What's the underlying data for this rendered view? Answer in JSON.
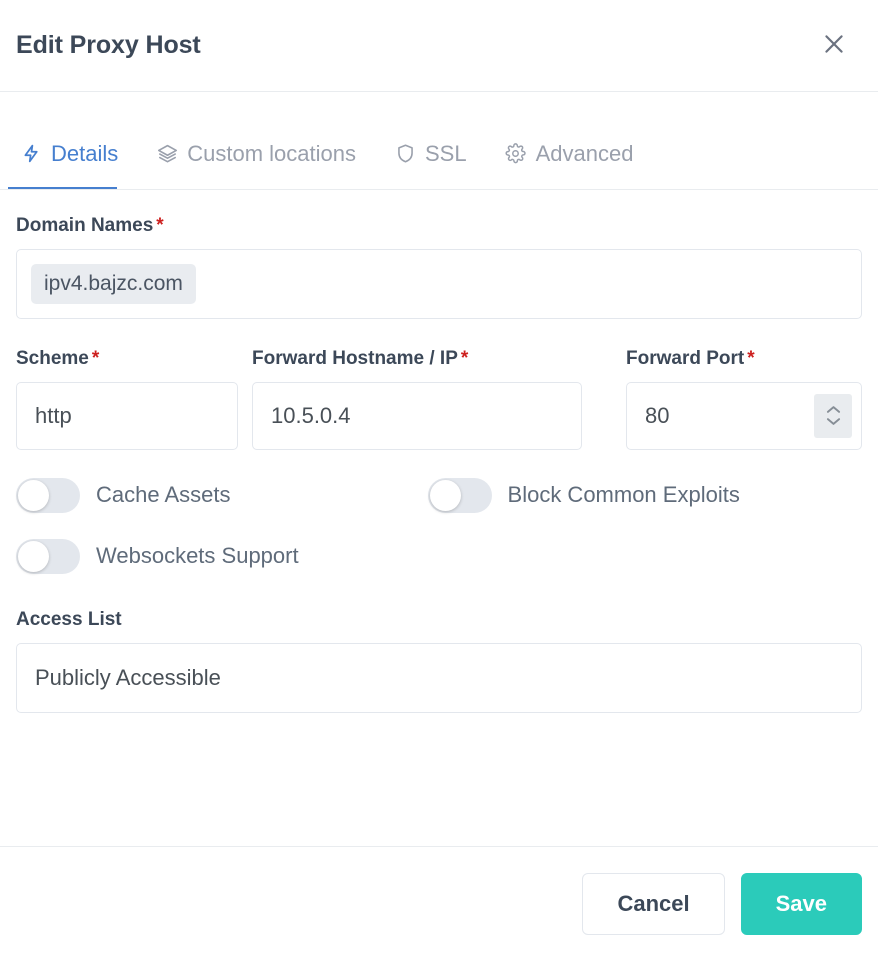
{
  "header": {
    "title": "Edit Proxy Host",
    "close_icon": "close-icon"
  },
  "tabs": [
    {
      "label": "Details",
      "icon": "bolt-icon",
      "active": true
    },
    {
      "label": "Custom locations",
      "icon": "layers-icon",
      "active": false
    },
    {
      "label": "SSL",
      "icon": "shield-icon",
      "active": false
    },
    {
      "label": "Advanced",
      "icon": "gear-icon",
      "active": false
    }
  ],
  "form": {
    "domain_names": {
      "label": "Domain Names",
      "required_marker": "*",
      "tags": [
        "ipv4.bajzc.com"
      ]
    },
    "scheme": {
      "label": "Scheme",
      "required_marker": "*",
      "value": "http"
    },
    "forward_hostname": {
      "label": "Forward Hostname / IP",
      "required_marker": "*",
      "value": "10.5.0.4"
    },
    "forward_port": {
      "label": "Forward Port",
      "required_marker": "*",
      "value": "80",
      "stepper_icon": "up-down-chevron-icon"
    },
    "toggles": [
      {
        "label": "Cache Assets",
        "on": false
      },
      {
        "label": "Block Common Exploits",
        "on": false
      },
      {
        "label": "Websockets Support",
        "on": false
      }
    ],
    "access_list": {
      "label": "Access List",
      "value": "Publicly Accessible"
    }
  },
  "footer": {
    "cancel_label": "Cancel",
    "save_label": "Save"
  },
  "colors": {
    "accent_blue": "#467fcf",
    "save_teal": "#2bcbba",
    "required_red": "#cd201f",
    "text_dark": "#3c4858",
    "text_muted": "#9aa0ac",
    "border": "#e3e7ed",
    "tag_bg": "#e9ecf0"
  }
}
